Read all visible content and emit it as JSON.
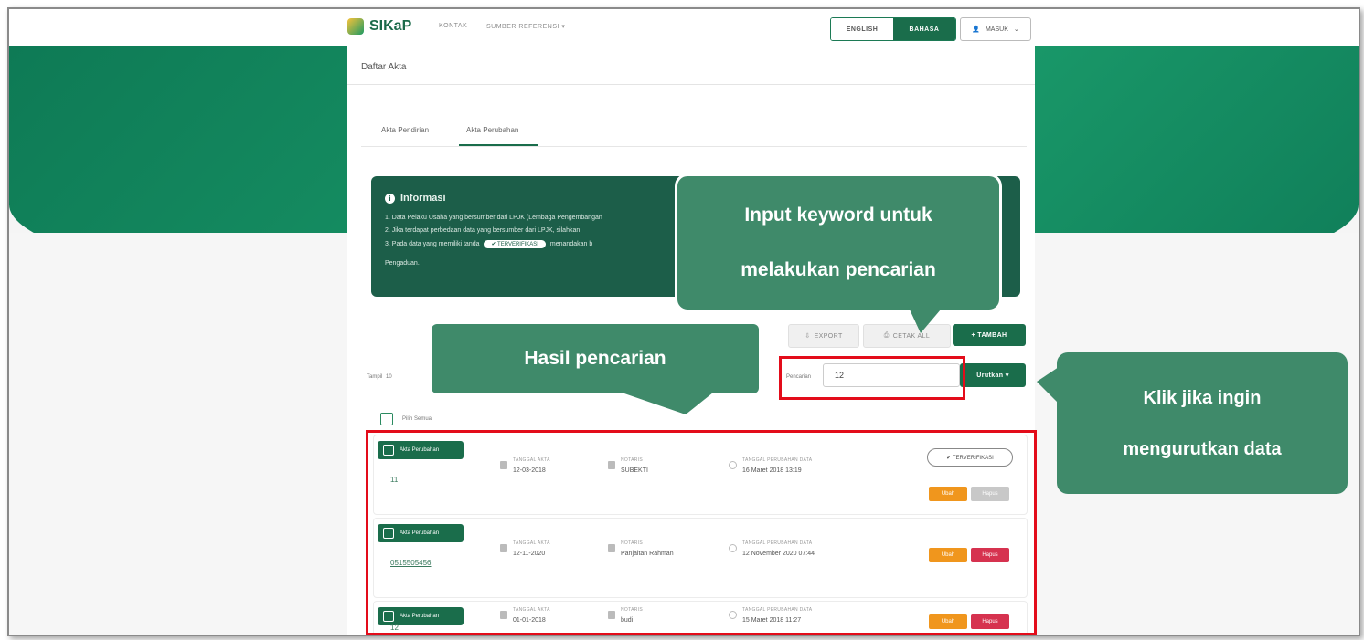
{
  "header": {
    "logo_text": "SIKaP",
    "nav": [
      "KONTAK",
      "SUMBER REFERENSI ▾"
    ],
    "lang_en": "ENGLISH",
    "lang_id": "BAHASA",
    "login": "MASUK"
  },
  "page": {
    "title": "Daftar Akta",
    "tabs": [
      "Akta Pendirian",
      "Akta Perubahan"
    ]
  },
  "info": {
    "title": "Informasi",
    "lines": [
      "1. Data Pelaku Usaha yang bersumber dari LPJK (Lembaga Pengembangan",
      "2. Jika terdapat perbedaan data yang bersumber dari LPJK, silahkan",
      "3. Pada data yang memiliki tanda",
      "Pengaduan."
    ],
    "badge": "✔ TERVERIFIKASI",
    "line3_suffix": "menandakan b"
  },
  "toolbar": {
    "export": "EXPORT",
    "cetak": "CETAK ALL",
    "tambah": "+ TAMBAH",
    "show_label": "Tampil",
    "show_value": "10",
    "search_label": "Pencarian",
    "search_value": "12",
    "sort": "Urutkan ▾",
    "select_all": "Pilih Semua"
  },
  "cards": [
    {
      "tag": "Akta Perubahan",
      "no": "11",
      "date_label": "TANGGAL AKTA",
      "date": "12-03-2018",
      "notary_label": "NOTARIS",
      "notary": "SUBEKTI",
      "time_label": "TANGGAL PERUBAHAN DATA",
      "time": "16 Maret 2018 13:19",
      "verified": "✔ TERVERIFIKASI",
      "edit": "Ubah",
      "delete": "Hapus"
    },
    {
      "tag": "Akta Perubahan",
      "no": "0515505456",
      "date_label": "TANGGAL AKTA",
      "date": "12-11-2020",
      "notary_label": "NOTARIS",
      "notary": "Panjaitan Rahman",
      "time_label": "TANGGAL PERUBAHAN DATA",
      "time": "12 November 2020 07:44",
      "edit": "Ubah",
      "delete": "Hapus"
    },
    {
      "tag": "Akta Perubahan",
      "no": "12",
      "date_label": "TANGGAL AKTA",
      "date": "01-01-2018",
      "notary_label": "NOTARIS",
      "notary": "budi",
      "time_label": "TANGGAL PERUBAHAN DATA",
      "time": "15 Maret 2018 11:27",
      "edit": "Ubah",
      "delete": "Hapus"
    }
  ],
  "callouts": {
    "search": [
      "Input keyword untuk",
      "melakukan pencarian"
    ],
    "result": "Hasil pencarian",
    "sort": [
      "Klik jika ingin",
      "mengurutkan data"
    ]
  },
  "colors": {
    "brand": "#1a6d4b",
    "callout": "#3f8a6a",
    "highlight": "#e30c1a",
    "edit": "#f0961d",
    "delete": "#d6324f"
  }
}
